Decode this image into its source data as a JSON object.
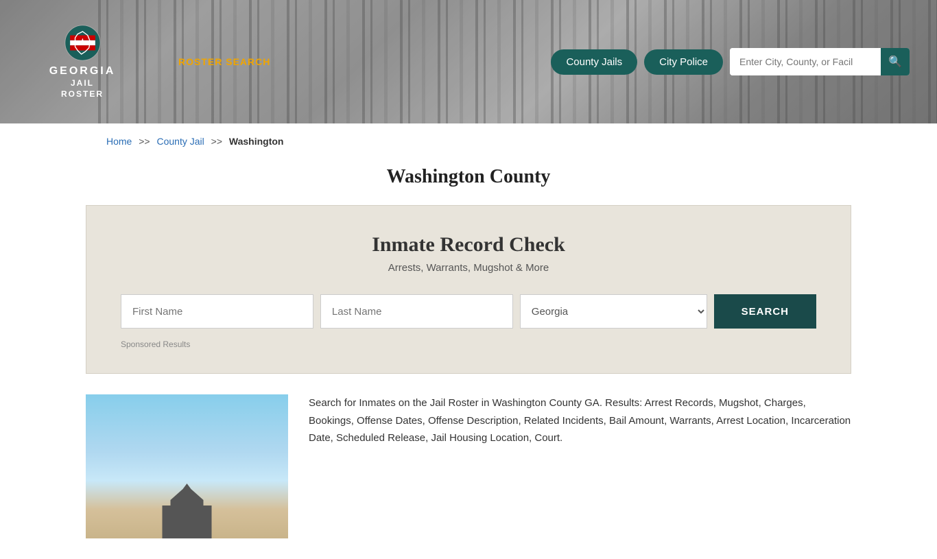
{
  "header": {
    "logo_line1": "GEORGIA",
    "logo_line2": "JAIL",
    "logo_line3": "ROSTER",
    "nav_link": "ROSTER SEARCH",
    "btn_county": "County Jails",
    "btn_city": "City Police",
    "search_placeholder": "Enter City, County, or Facil"
  },
  "breadcrumb": {
    "home": "Home",
    "sep1": ">>",
    "county_jail": "County Jail",
    "sep2": ">>",
    "current": "Washington"
  },
  "page_title": "Washington County",
  "record_check": {
    "title": "Inmate Record Check",
    "subtitle": "Arrests, Warrants, Mugshot & More",
    "first_name_placeholder": "First Name",
    "last_name_placeholder": "Last Name",
    "state_default": "Georgia",
    "search_btn": "SEARCH",
    "sponsored": "Sponsored Results"
  },
  "bottom_text": "Search for Inmates on the Jail Roster in Washington County GA. Results: Arrest Records, Mugshot, Charges, Bookings, Offense Dates, Offense Description, Related Incidents, Bail Amount, Warrants, Arrest Location, Incarceration Date, Scheduled Release, Jail Housing Location, Court."
}
